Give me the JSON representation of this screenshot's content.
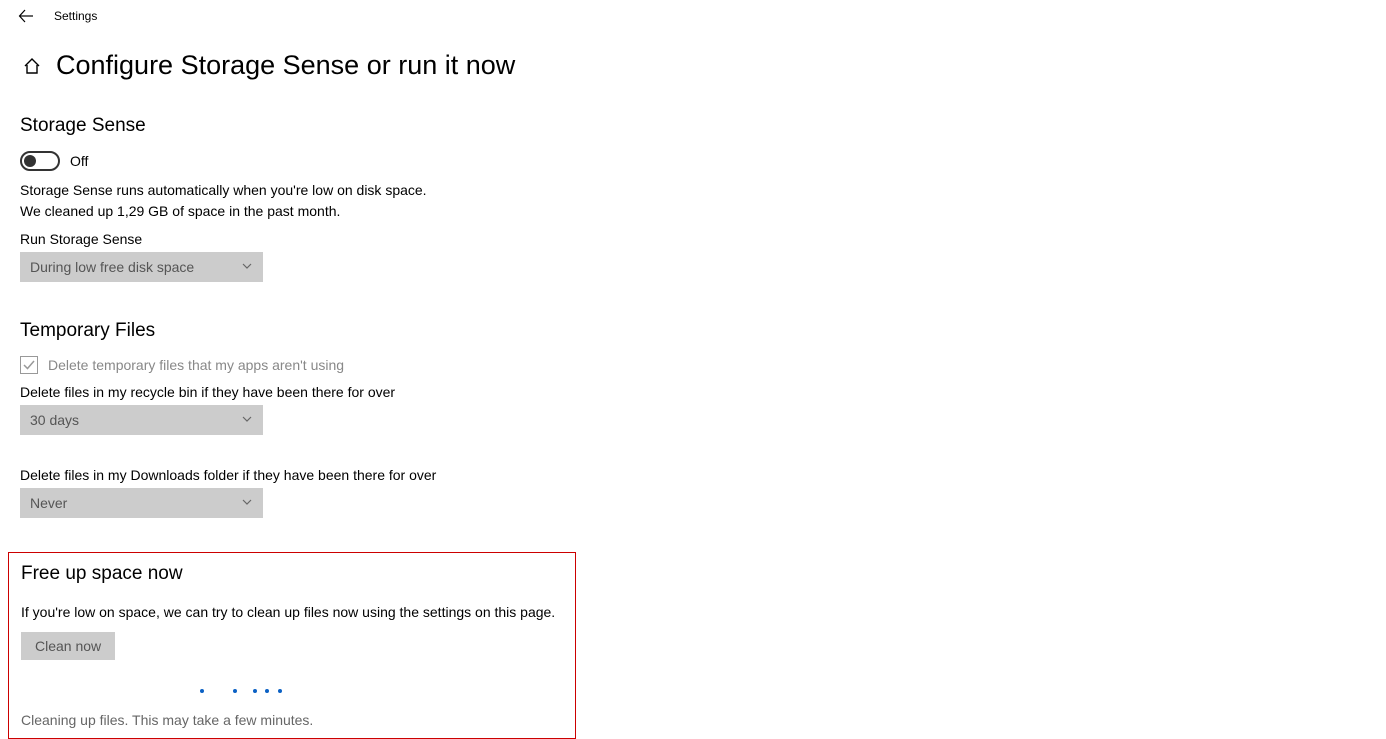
{
  "app": {
    "title": "Settings"
  },
  "page": {
    "title": "Configure Storage Sense or run it now"
  },
  "storage_sense": {
    "heading": "Storage Sense",
    "toggle_state": "Off",
    "desc_line1": "Storage Sense runs automatically when you're low on disk space.",
    "desc_line2": "We cleaned up 1,29 GB of space in the past month.",
    "run_label": "Run Storage Sense",
    "run_selected": "During low free disk space"
  },
  "temporary_files": {
    "heading": "Temporary Files",
    "checkbox_label": "Delete temporary files that my apps aren't using",
    "recycle_label": "Delete files in my recycle bin if they have been there for over",
    "recycle_selected": "30 days",
    "downloads_label": "Delete files in my Downloads folder if they have been there for over",
    "downloads_selected": "Never"
  },
  "free_up": {
    "heading": "Free up space now",
    "desc": "If you're low on space, we can try to clean up files now using the settings on this page.",
    "button_label": "Clean now",
    "status": "Cleaning up files. This may take a few minutes."
  }
}
